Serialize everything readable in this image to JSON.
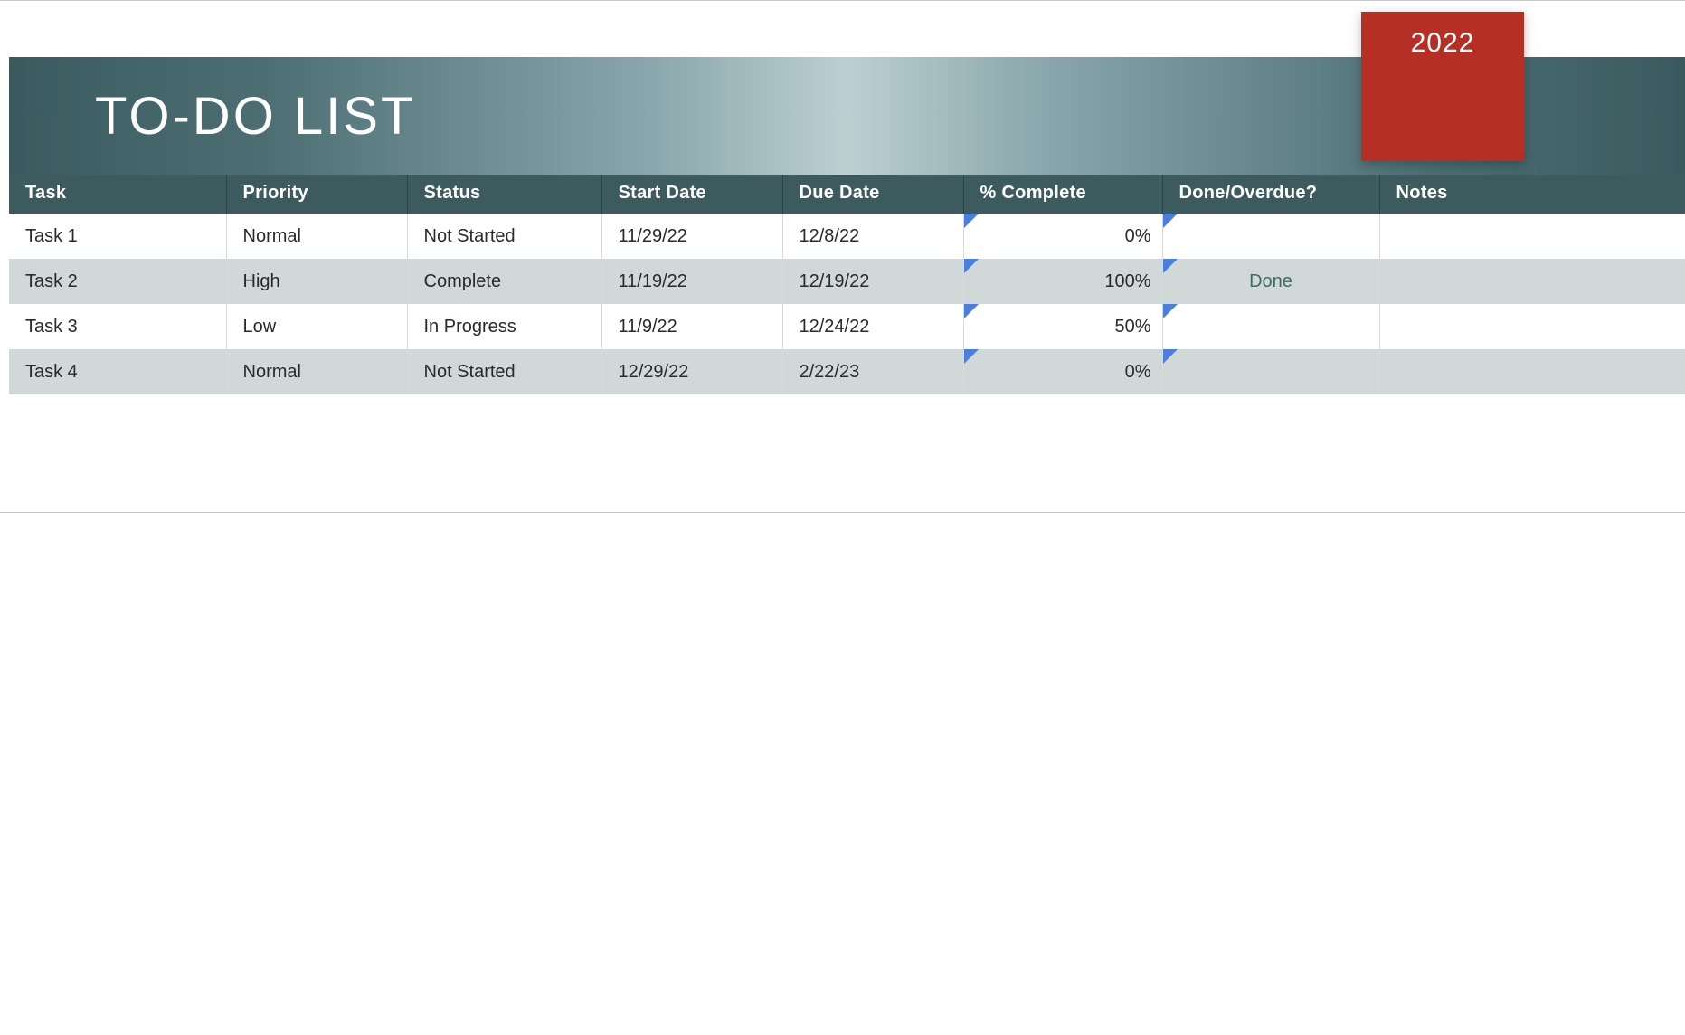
{
  "header": {
    "title": "TO-DO LIST",
    "year": "2022"
  },
  "table": {
    "columns": {
      "task": "Task",
      "priority": "Priority",
      "status": "Status",
      "start_date": "Start Date",
      "due_date": "Due Date",
      "pct_complete": "% Complete",
      "done_overdue": "Done/Overdue?",
      "notes": "Notes"
    },
    "rows": [
      {
        "task": "Task 1",
        "priority": "Normal",
        "status": "Not Started",
        "start_date": "11/29/22",
        "due_date": "12/8/22",
        "pct_complete": "0%",
        "done_overdue": "",
        "notes": ""
      },
      {
        "task": "Task 2",
        "priority": "High",
        "status": "Complete",
        "start_date": "11/19/22",
        "due_date": "12/19/22",
        "pct_complete": "100%",
        "done_overdue": "Done",
        "notes": ""
      },
      {
        "task": "Task 3",
        "priority": "Low",
        "status": "In Progress",
        "start_date": "11/9/22",
        "due_date": "12/24/22",
        "pct_complete": "50%",
        "done_overdue": "",
        "notes": ""
      },
      {
        "task": "Task 4",
        "priority": "Normal",
        "status": "Not Started",
        "start_date": "12/29/22",
        "due_date": "2/22/23",
        "pct_complete": "0%",
        "done_overdue": "",
        "notes": ""
      }
    ]
  }
}
